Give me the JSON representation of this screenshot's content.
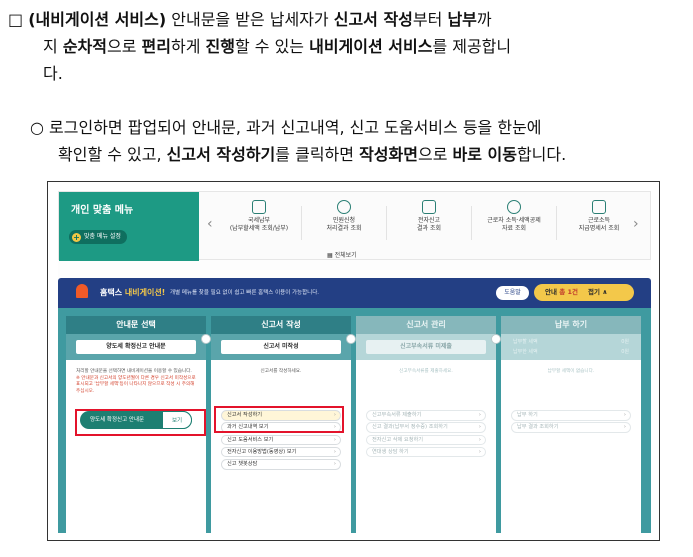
{
  "paragraph1": {
    "bullet": "□",
    "line1": [
      {
        "t": "(내비게이션 서비스)",
        "b": true
      },
      {
        "t": " 안내문을 받은 납세자가 ",
        "b": false
      },
      {
        "t": "신고서 작성",
        "b": true
      },
      {
        "t": "부터 ",
        "b": false
      },
      {
        "t": "납부",
        "b": true
      },
      {
        "t": "까",
        "b": false
      }
    ],
    "line2": [
      {
        "t": "지 ",
        "b": false
      },
      {
        "t": "순차적",
        "b": true
      },
      {
        "t": "으로 ",
        "b": false
      },
      {
        "t": "편리",
        "b": true
      },
      {
        "t": "하게 ",
        "b": false
      },
      {
        "t": "진행",
        "b": true
      },
      {
        "t": "할 수 있는 ",
        "b": false
      },
      {
        "t": "내비게이션 서비스",
        "b": true
      },
      {
        "t": "를 제공합니",
        "b": false
      }
    ],
    "line3": [
      {
        "t": "다.",
        "b": false
      }
    ]
  },
  "paragraph2": {
    "bullet": "○",
    "line1": [
      {
        "t": " 로그인하면 팝업되어 안내문, 과거 신고내역, 신고 도움서비스 등을 한눈에",
        "b": false
      }
    ],
    "line2": [
      {
        "t": "확인할 수 있고, ",
        "b": false
      },
      {
        "t": "신고서 작성하기",
        "b": true
      },
      {
        "t": "를 클릭하면 ",
        "b": false
      },
      {
        "t": "작성화면",
        "b": true
      },
      {
        "t": "으로 ",
        "b": false
      },
      {
        "t": "바로 이동",
        "b": true
      },
      {
        "t": "합니다.",
        "b": false
      }
    ]
  },
  "screenshot": {
    "menu": {
      "title": "개인 맞춤 메뉴",
      "setting_button": "맞춤 메뉴 설정",
      "items": [
        {
          "line1": "국세납부",
          "line2": "(납부할세액 조회/납부)"
        },
        {
          "line1": "민원신청",
          "line2": "처리결과 조회"
        },
        {
          "line1": "전자신고",
          "line2": "결과 조회"
        },
        {
          "line1": "근로자 소득·세액공제",
          "line2": "자료 조회"
        },
        {
          "line1": "근로소득",
          "line2": "지급명세서 조회"
        }
      ],
      "all_view": "전체보기"
    },
    "banner": {
      "title_prefix": "홈택스 ",
      "title_highlight": "내비게이션!",
      "description": "개별 메뉴를 찾을 필요 없이 쉽고 빠른 홈택스 이용이 가능합니다.",
      "help_button": "도움말",
      "notice_label": "안내 ",
      "notice_count": "총 1건",
      "notice_toggle": "접기 ∧"
    },
    "columns": [
      {
        "head": "안내문 선택",
        "chip": "양도세 확정신고 안내문",
        "note": "처리할 안내문을 선택하면 내비게이션을 이용할 수 있습니다.",
        "note_red": "※ 안내문과 신고서의 양도년월이 다른 경우 신고서 미작성으로 표시되고 '납부할 세액'등이 나타나지 않으므로 작성 시 주의해주십시오.",
        "selected_item": "양도세 확정신고 안내문",
        "view_button": "보기"
      },
      {
        "head": "신고서 작성",
        "chip": "신고서 미작성",
        "note": "신고서를 작성하세요.",
        "items": [
          "신고서 작성하기",
          "과거 신고내역 보기",
          "신고 도움서비스 보기",
          "전자신고 이용방법(동영상) 보기",
          "신고 챗봇상담"
        ]
      },
      {
        "head": "신고서 관리",
        "chip": "신고부속서류 미제출",
        "note": "신고부속서류를 제출하세요.",
        "items": [
          "신고부속서류 제출하기",
          "신고 결과(납부서 정수증) 조회하기",
          "전자신고 삭제 요청하기",
          "연대생 상담 하기"
        ]
      },
      {
        "head": "납부 하기",
        "rows": [
          {
            "label": "납부할 세액",
            "value": "0원"
          },
          {
            "label": "납부한 세액",
            "value": "0원"
          }
        ],
        "note": "납부할 세액이 없습니다.",
        "items": [
          "납부 하기",
          "납부 결과 조회하기"
        ]
      }
    ]
  }
}
